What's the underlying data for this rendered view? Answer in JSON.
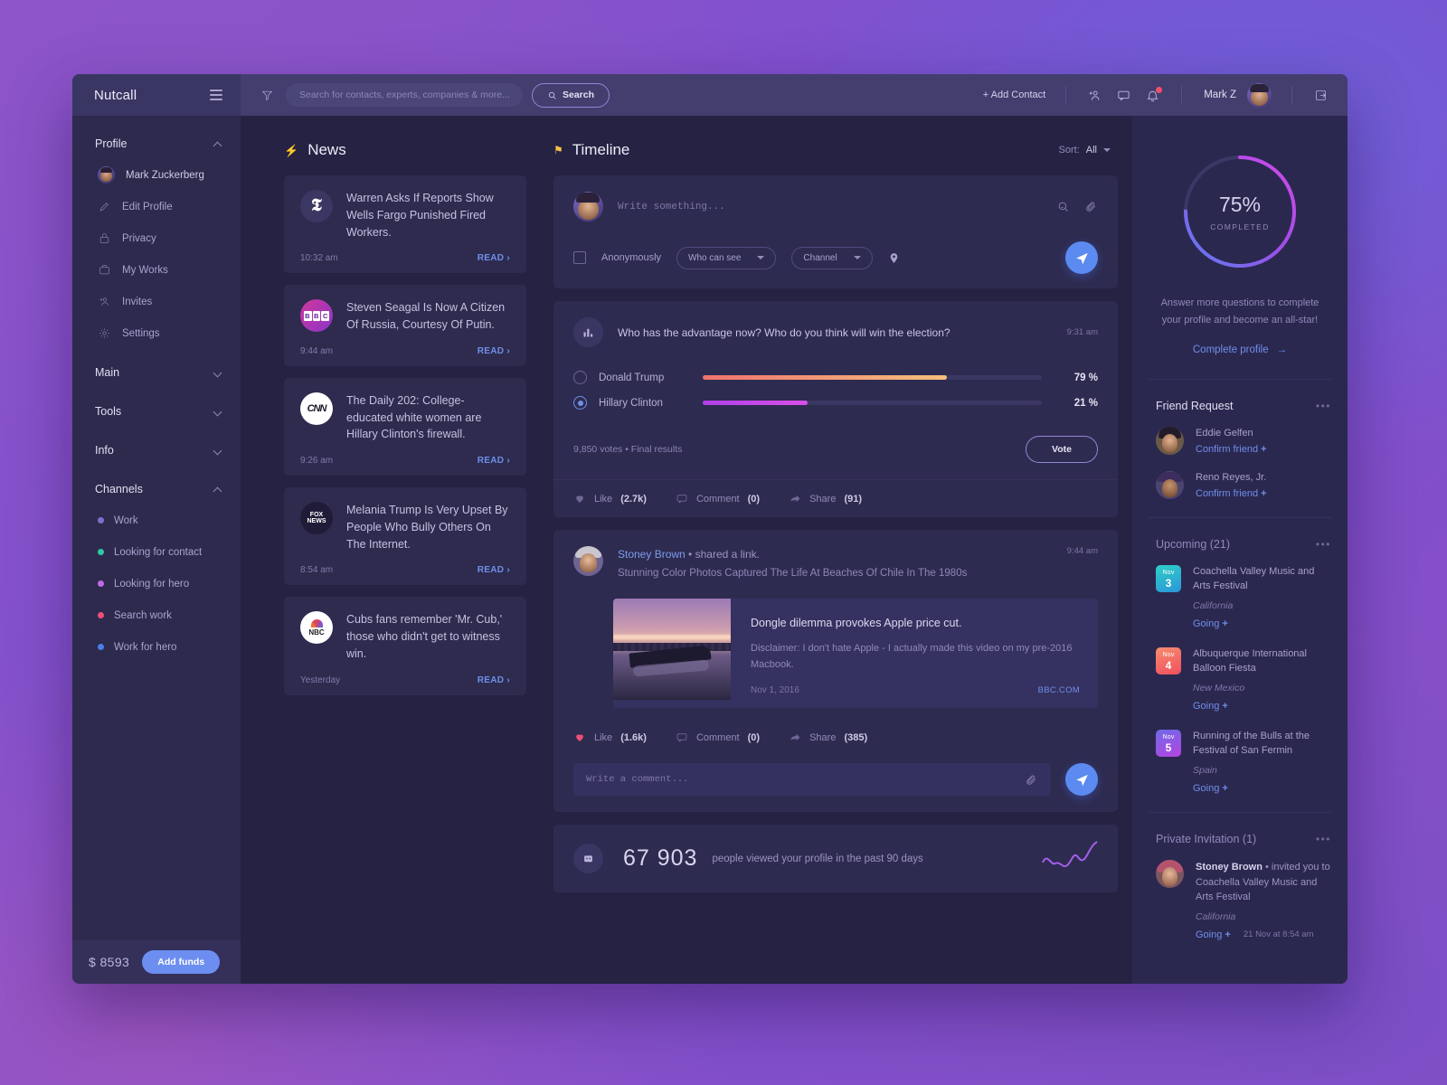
{
  "brand": "Nutcall",
  "sidebar": {
    "groups": [
      {
        "label": "Profile",
        "expanded": true
      },
      {
        "label": "Main",
        "expanded": false
      },
      {
        "label": "Tools",
        "expanded": false
      },
      {
        "label": "Info",
        "expanded": false
      },
      {
        "label": "Channels",
        "expanded": true
      }
    ],
    "profile_items": [
      {
        "label": "Mark Zuckerberg",
        "icon": "avatar"
      },
      {
        "label": "Edit Profile",
        "icon": "pencil-icon"
      },
      {
        "label": "Privacy",
        "icon": "lock-icon"
      },
      {
        "label": "My Works",
        "icon": "briefcase-icon"
      },
      {
        "label": "Invites",
        "icon": "add-person-icon"
      },
      {
        "label": "Settings",
        "icon": "gear-icon"
      }
    ],
    "channels": [
      {
        "label": "Work",
        "color": "#7a72c9"
      },
      {
        "label": "Looking for contact",
        "color": "#2ec9a0"
      },
      {
        "label": "Looking for hero",
        "color": "#c06ae8"
      },
      {
        "label": "Search work",
        "color": "#ef4f77"
      },
      {
        "label": "Work for hero",
        "color": "#4a7ee8"
      }
    ],
    "footer": {
      "balance": "$ 8593",
      "add_funds_label": "Add funds"
    }
  },
  "topbar": {
    "search_placeholder": "Search for contacts, experts, companies & more...",
    "search_value": "",
    "search_button": "Search",
    "add_contact": "+ Add Contact",
    "user_name": "Mark Z",
    "notification_count": "1"
  },
  "news": {
    "title": "News",
    "items": [
      {
        "source": "nyt",
        "source_label": "The New York Times",
        "title": "Warren Asks If Reports Show Wells Fargo Punished Fired Workers.",
        "time": "10:32 am",
        "read": "READ"
      },
      {
        "source": "bbc",
        "source_label": "BBC",
        "title": "Steven Seagal Is Now A Citizen Of Russia, Courtesy Of Putin.",
        "time": "9:44 am",
        "read": "READ"
      },
      {
        "source": "cnn",
        "source_label": "CNN",
        "title": "The Daily 202: College-educated white women are Hillary Clinton's firewall.",
        "time": "9:26 am",
        "read": "READ"
      },
      {
        "source": "fox",
        "source_label": "FOX NEWS",
        "title": "Melania Trump Is Very Upset By People Who Bully Others On The Internet.",
        "time": "8:54 am",
        "read": "READ"
      },
      {
        "source": "nbc",
        "source_label": "NBC",
        "title": "Cubs fans remember 'Mr. Cub,' those who didn't get to witness win.",
        "time": "Yesterday",
        "read": "READ"
      }
    ]
  },
  "timeline": {
    "title": "Timeline",
    "sort_label": "Sort:",
    "sort_value": "All",
    "composer": {
      "placeholder": "Write something...",
      "value": "",
      "anonymously_label": "Anonymously",
      "who_can_see": "Who can see",
      "channel": "Channel"
    },
    "poll": {
      "question": "Who has the advantage now? Who do you think will win the election?",
      "time": "9:31 am",
      "options": [
        {
          "name": "Donald Trump",
          "percent": 79,
          "percent_label": "79 %",
          "selected": false,
          "color_from": "#f0736e",
          "color_to": "#f3c07d"
        },
        {
          "name": "Hillary Clinton",
          "percent": 21,
          "percent_label": "21 %",
          "selected": true,
          "color_from": "#b041e8",
          "color_to": "#d94fe8"
        }
      ],
      "meta": "9,850 votes • Final results",
      "vote_label": "Vote",
      "actions": {
        "like": "Like",
        "like_count": "(2.7k)",
        "comment": "Comment",
        "comment_count": "(0)",
        "share": "Share",
        "share_count": "(91)"
      }
    },
    "post": {
      "author": "Stoney Brown",
      "action": "shared a link.",
      "subtitle": "Stunning Color Photos Captured The Life At Beaches Of Chile In The 1980s",
      "time": "9:44 am",
      "link": {
        "title": "Dongle dilemma provokes Apple price cut.",
        "description": "Disclaimer: I don't hate Apple - I actually made this video on my pre-2016 Macbook.",
        "date": "Nov 1, 2016",
        "source": "BBC.COM"
      },
      "actions": {
        "like": "Like",
        "like_count": "(1.6k)",
        "comment": "Comment",
        "comment_count": "(0)",
        "share": "Share",
        "share_count": "(385)"
      },
      "comment_placeholder": "Write a comment...",
      "comment_value": ""
    },
    "stat": {
      "number": "67 903",
      "text": "people viewed your profile in the past 90 days"
    }
  },
  "right": {
    "progress": {
      "percent": "75%",
      "percent_value": 75,
      "label": "COMPLETED",
      "note": "Answer more questions to complete your profile and become an all-star!",
      "cta": "Complete profile"
    },
    "friend_request": {
      "title": "Friend Request",
      "items": [
        {
          "name": "Eddie Gelfen",
          "action": "Confirm friend",
          "avatar": "a1"
        },
        {
          "name": "Reno Reyes, Jr.",
          "action": "Confirm friend",
          "avatar": "a2"
        }
      ]
    },
    "upcoming": {
      "title": "Upcoming",
      "count": "(21)",
      "items": [
        {
          "month": "Nov",
          "day": "3",
          "title": "Coachella Valley Music and Arts Festival",
          "place": "California",
          "going": "Going",
          "color_from": "#2fd0c6",
          "color_to": "#2a95d8"
        },
        {
          "month": "Nov",
          "day": "4",
          "title": "Albuquerque International Balloon Fiesta",
          "place": "New Mexico",
          "going": "Going",
          "color_from": "#f78d6e",
          "color_to": "#ef4f5e"
        },
        {
          "month": "Nov",
          "day": "5",
          "title": "Running of the Bulls at the Festival of San Fermin",
          "place": "Spain",
          "going": "Going",
          "color_from": "#6f6ae8",
          "color_to": "#b544e0"
        }
      ]
    },
    "private_invitation": {
      "title": "Private Invitation",
      "count": "(1)",
      "author": "Stoney Brown",
      "text": " • invited you to Coachella Valley Music and Arts Festival",
      "place": "California",
      "going": "Going",
      "time": "21 Nov at 8:54 am"
    }
  }
}
